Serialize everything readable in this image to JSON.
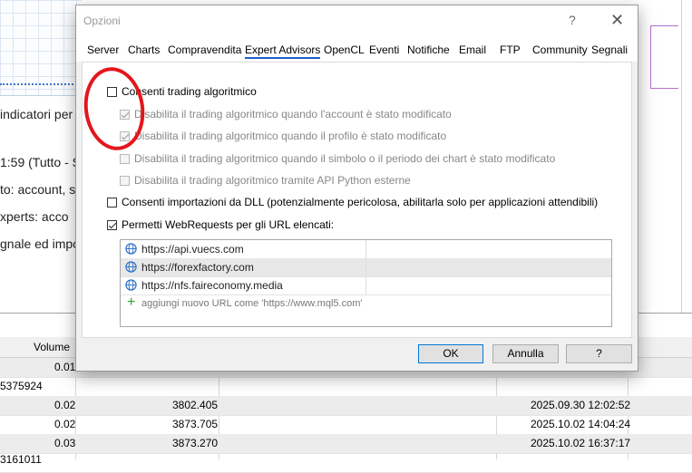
{
  "background": {
    "left_lines": [
      "indicatori per",
      "1:59 (Tutto - S",
      "to: account, s",
      "xperts: acco",
      "gnale ed impo"
    ],
    "table_header_volume": "Volume",
    "rows": [
      {
        "a": "",
        "volume": "0.01",
        "price": "",
        "time": ""
      },
      {
        "a": "5375924",
        "volume": "",
        "price": "",
        "time": ""
      },
      {
        "a": "",
        "volume": "0.02",
        "price": "3802.405",
        "time": "2025.09.30 12:02:52"
      },
      {
        "a": "",
        "volume": "0.02",
        "price": "3873.705",
        "time": "2025.10.02 14:04:24"
      },
      {
        "a": "",
        "volume": "0.03",
        "price": "3873.270",
        "time": "2025.10.02 16:37:17"
      },
      {
        "a": "3161011",
        "volume": "",
        "price": "",
        "time": ""
      }
    ]
  },
  "dialog": {
    "title": "Opzioni",
    "help_glyph": "?",
    "close_glyph": "✕",
    "tabs": [
      "Server",
      "Charts",
      "Compravendita",
      "Expert Advisors",
      "OpenCL",
      "Eventi",
      "Notifiche",
      "Email",
      "FTP",
      "Community",
      "Segnali"
    ],
    "active_tab": "Expert Advisors",
    "options": {
      "algo_trading": "Consenti trading algoritmico",
      "disable_account": "Disabilita il trading algoritmico quando l'account è stato modificato",
      "disable_profile": "Disabilita il trading algoritmico quando il profilo è stato modificato",
      "disable_symbol": "Disabilita il trading algoritmico quando il simbolo o il periodo dei chart è stato modificato",
      "disable_python": "Disabilita il trading algoritmico tramite API Python esterne",
      "dll_imports": "Consenti importazioni da DLL (potenzialmente pericolosa, abilitarla solo per applicazioni attendibili)",
      "webrequests": "Permetti WebRequests per gli URL elencati:"
    },
    "urls": [
      "https://api.vuecs.com",
      "https://forexfactory.com",
      "https://nfs.faireconomy.media"
    ],
    "add_url_placeholder": "aggiungi nuovo URL come 'https://www.mql5.com'",
    "buttons": {
      "ok": "OK",
      "cancel": "Annulla",
      "help": "?"
    }
  }
}
